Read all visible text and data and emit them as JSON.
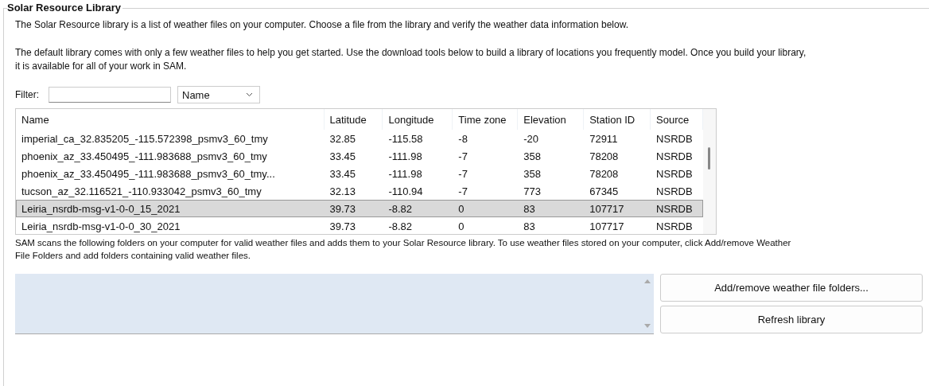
{
  "group": {
    "title": "Solar Resource Library"
  },
  "intro": [
    "The Solar Resource library is a list of weather files on your computer. Choose a file from the library and verify the weather data information below.",
    "The default library comes with only a few weather files to help you get started. Use the download tools below to build a library of locations you frequently model. Once you build your library, it is available for all of your work in SAM."
  ],
  "filter": {
    "label": "Filter:",
    "dropdown": "Name"
  },
  "table": {
    "columns": [
      "Name",
      "Latitude",
      "Longitude",
      "Time zone",
      "Elevation",
      "Station ID",
      "Source"
    ],
    "rows": [
      {
        "cells": [
          "imperial_ca_32.835205_-115.572398_psmv3_60_tmy",
          "32.85",
          "-115.58",
          "-8",
          "-20",
          "72911",
          "NSRDB"
        ],
        "selected": false
      },
      {
        "cells": [
          "phoenix_az_33.450495_-111.983688_psmv3_60_tmy",
          "33.45",
          "-111.98",
          "-7",
          "358",
          "78208",
          "NSRDB"
        ],
        "selected": false
      },
      {
        "cells": [
          "phoenix_az_33.450495_-111.983688_psmv3_60_tmy...",
          "33.45",
          "-111.98",
          "-7",
          "358",
          "78208",
          "NSRDB"
        ],
        "selected": false
      },
      {
        "cells": [
          "tucson_az_32.116521_-110.933042_psmv3_60_tmy",
          "32.13",
          "-110.94",
          "-7",
          "773",
          "67345",
          "NSRDB"
        ],
        "selected": false
      },
      {
        "cells": [
          "Leiria_nsrdb-msg-v1-0-0_15_2021",
          "39.73",
          "-8.82",
          "0",
          "83",
          "107717",
          "NSRDB"
        ],
        "selected": true
      },
      {
        "cells": [
          "Leiria_nsrdb-msg-v1-0-0_30_2021",
          "39.73",
          "-8.82",
          "0",
          "83",
          "107717",
          "NSRDB"
        ],
        "selected": false
      }
    ]
  },
  "folders_note": "SAM scans the following folders on your computer for valid weather files and adds them to your Solar Resource library. To use weather files stored on your computer, click Add/remove Weather File Folders and add folders containing valid weather files.",
  "buttons": [
    "Add/remove weather file folders...",
    "Refresh library"
  ]
}
